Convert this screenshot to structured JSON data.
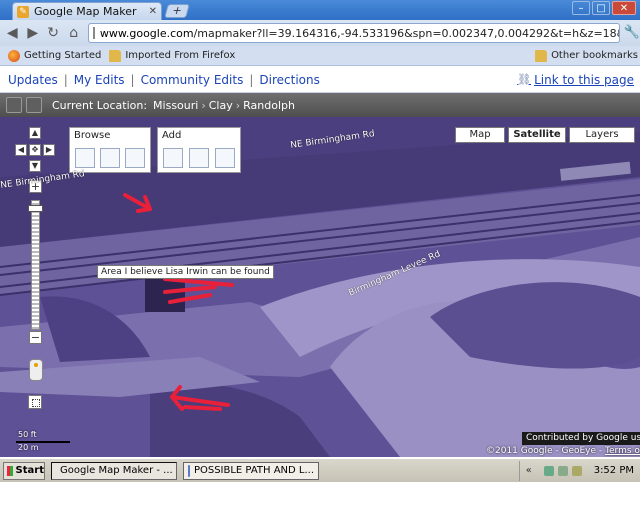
{
  "browser": {
    "tab_title": "Google Map Maker",
    "tab_favicon": "map-maker-icon",
    "url_host": "www.google.com",
    "url_path": "/mapmaker?ll=39.164316,-94.533196&spn=0.002347,0.004292&t=h&z=18&vp",
    "bookmarks": [
      {
        "label": "Getting Started",
        "icon": "firefox-icon"
      },
      {
        "label": "Imported From Firefox",
        "icon": "folder-icon"
      }
    ],
    "other_bookmarks": "Other bookmarks"
  },
  "mapmaker": {
    "nav": [
      "Updates",
      "My Edits",
      "Community Edits",
      "Directions"
    ],
    "link_to_page": "Link to this page",
    "current_location_label": "Current Location:",
    "breadcrumbs": [
      "Missouri",
      "Clay",
      "Randolph"
    ],
    "browse_title": "Browse",
    "add_title": "Add",
    "map_types": [
      "Map",
      "Satellite",
      "Layers"
    ],
    "selected_map_type": "Satellite"
  },
  "map": {
    "annotation": "Area I believe Lisa Irwin can be found",
    "roads": [
      "NE Birmingham Rd",
      "NE Birmingham Rd",
      "Birmingham Levee Rd"
    ],
    "scale_ft": "50 ft",
    "scale_m": "20 m",
    "contributed": "Contributed by Google users",
    "copyright": "©2011 Google - GeoEye -",
    "terms": "Terms of Use",
    "arrow_color": "#e8203a"
  },
  "taskbar": {
    "start": "Start",
    "tasks": [
      "Google Map Maker - ...",
      "POSSIBLE PATH AND L..."
    ],
    "time": "3:52 PM"
  }
}
